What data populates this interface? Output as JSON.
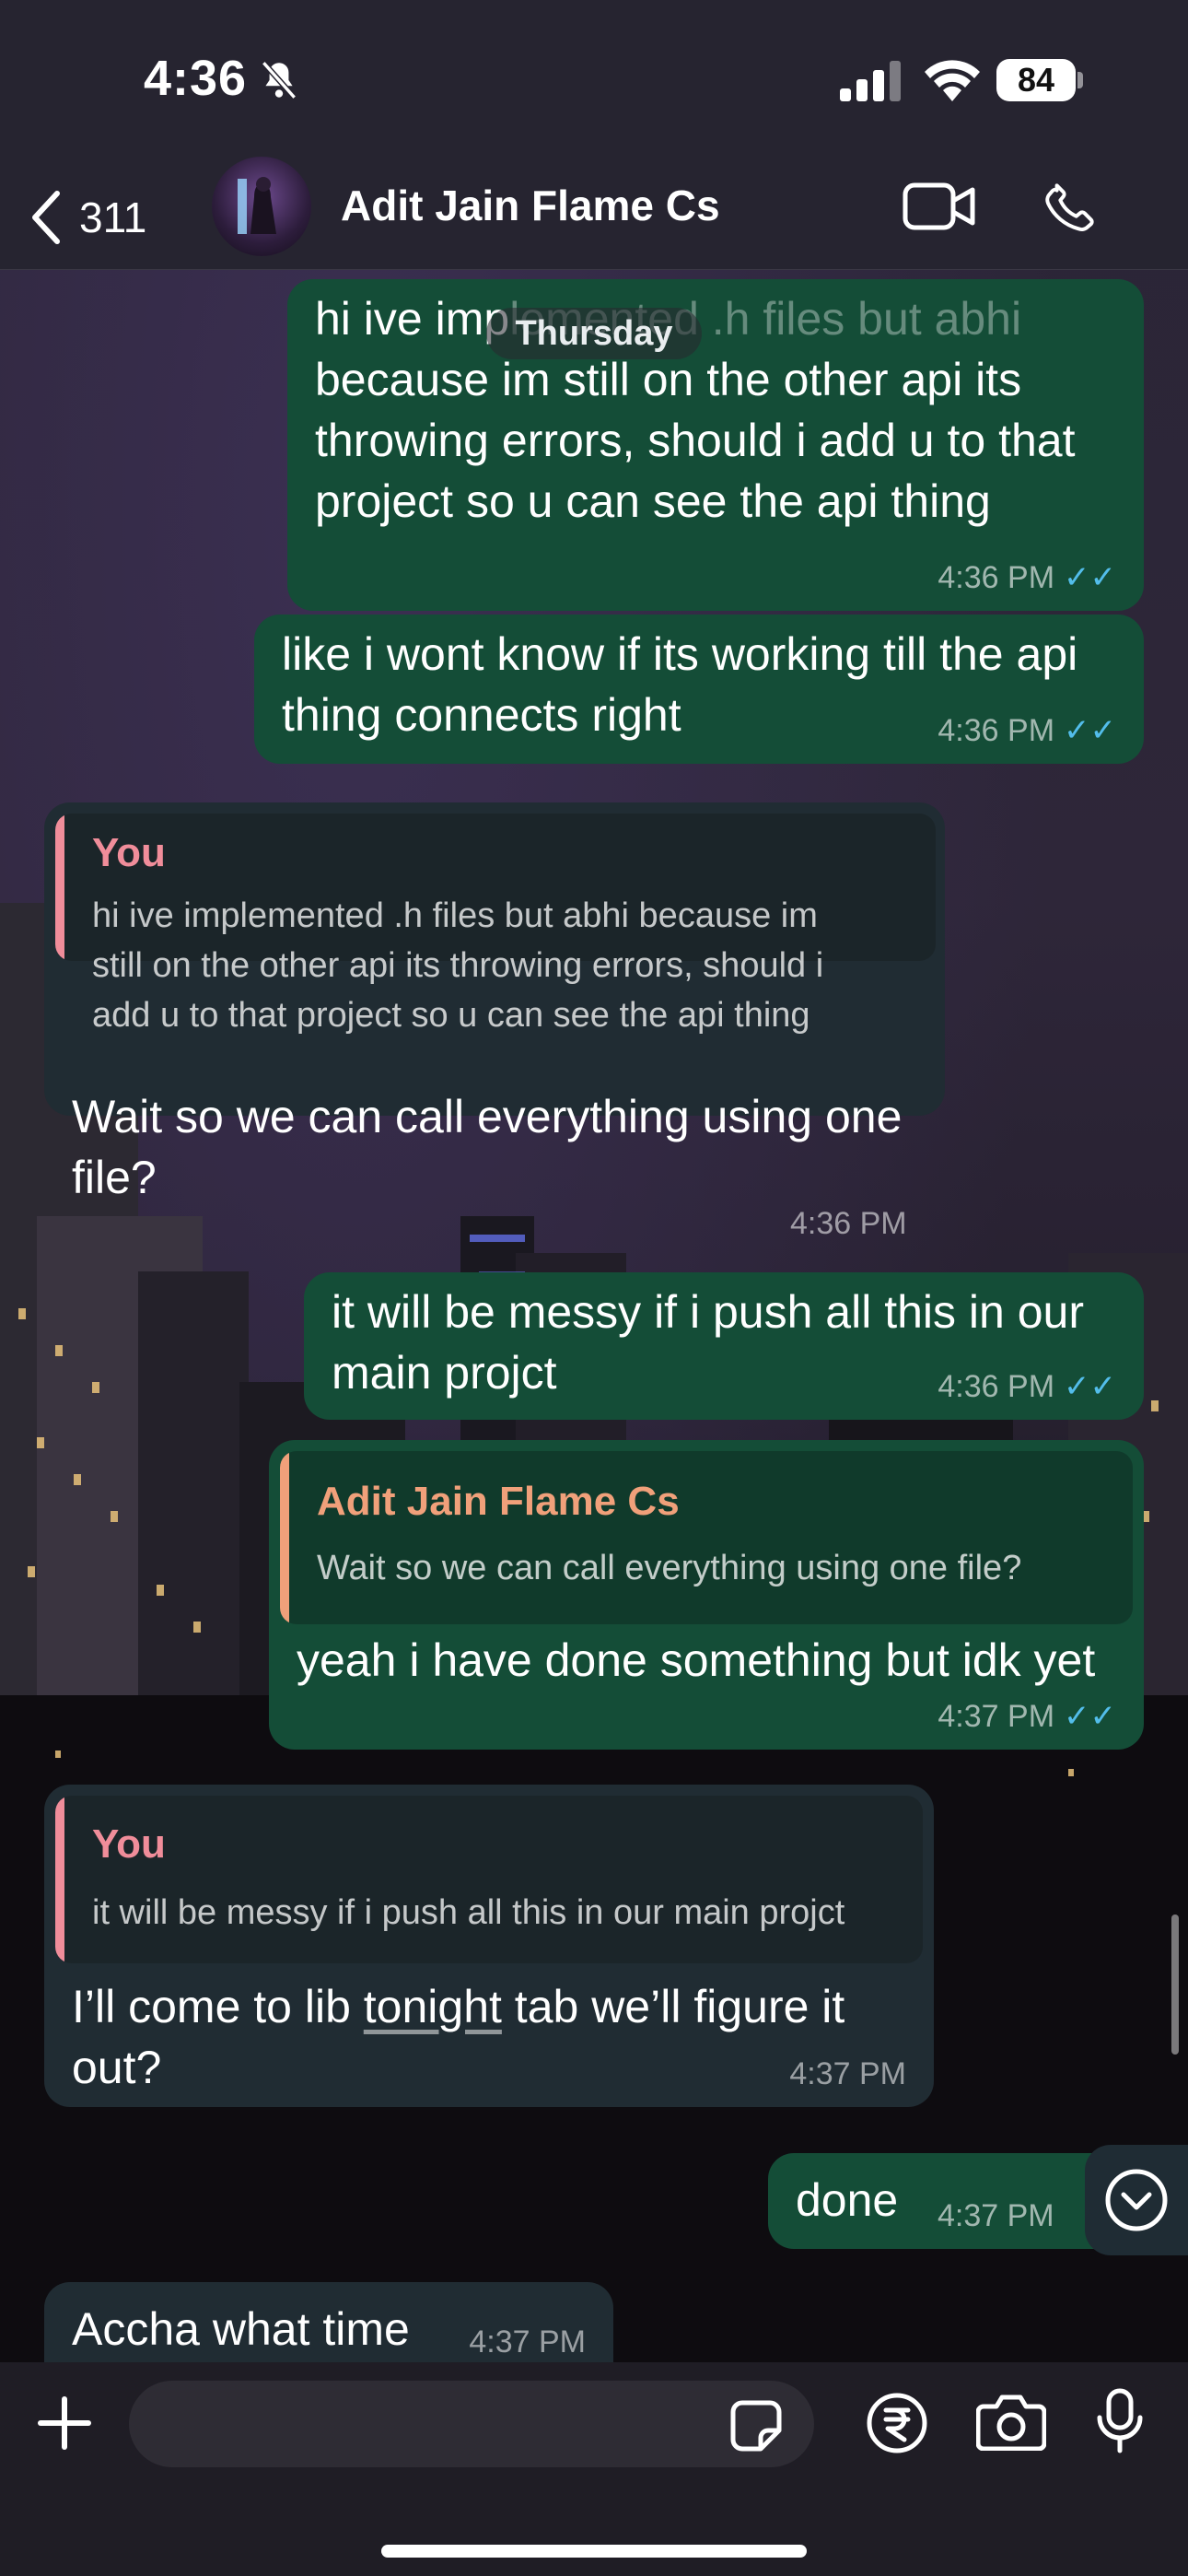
{
  "status_bar": {
    "time": "4:36",
    "battery": "84"
  },
  "header": {
    "back_count": "311",
    "contact_name": "Adit Jain Flame Cs"
  },
  "chat": {
    "day_label": "Thursday",
    "messages": [
      {
        "text_a": "hi ive imp",
        "text_b": "lemented .h files but abhi",
        "text_c": "because im still on the other api its",
        "text_d": "throwing errors, should i add u to that",
        "text_e": "project so u can see the api thing",
        "time": "4:36 PM"
      },
      {
        "text_a": "like i wont know if its working till the api",
        "text_b": "thing connects right",
        "time": "4:36 PM"
      },
      {
        "quote_name": "You",
        "quote_text_a": "hi ive implemented .h files but abhi because im",
        "quote_text_b": "still on the other api its throwing errors, should i",
        "quote_text_c": "add u to that project so u can see the api thing",
        "text_a": "Wait so we can call everything using one",
        "text_b": "file?",
        "time": "4:36 PM"
      },
      {
        "text_a": "it will be messy if i push all this in our",
        "text_b": "main projct",
        "time": "4:36 PM"
      },
      {
        "quote_name": "Adit Jain Flame Cs",
        "quote_text": "Wait so we can call everything using one file?",
        "text": "yeah i have done something but idk yet",
        "time": "4:37 PM"
      },
      {
        "quote_name": "You",
        "quote_text": "it will be messy if i push all this in our main projct",
        "text_a": "I’ll come to lib ",
        "text_link": "tonight",
        "text_b": " tab we’ll figure it",
        "text_c": "out?",
        "time": "4:37 PM"
      },
      {
        "text": "done",
        "time": "4:37 PM"
      },
      {
        "text": "Accha what time",
        "time": "4:37 PM"
      }
    ]
  },
  "colors": {
    "outgoing": "#144d37",
    "incoming": "#202c33",
    "read_ticks": "#53bdeb",
    "quote_you": "#f08d9a",
    "quote_contact": "#f0a07a"
  },
  "icons": [
    "bell-off-icon",
    "signal-icon",
    "wifi-icon",
    "back-chevron-icon",
    "video-call-icon",
    "phone-icon",
    "scroll-down-icon",
    "plus-icon",
    "sticker-icon",
    "rupee-icon",
    "camera-icon",
    "mic-icon"
  ]
}
